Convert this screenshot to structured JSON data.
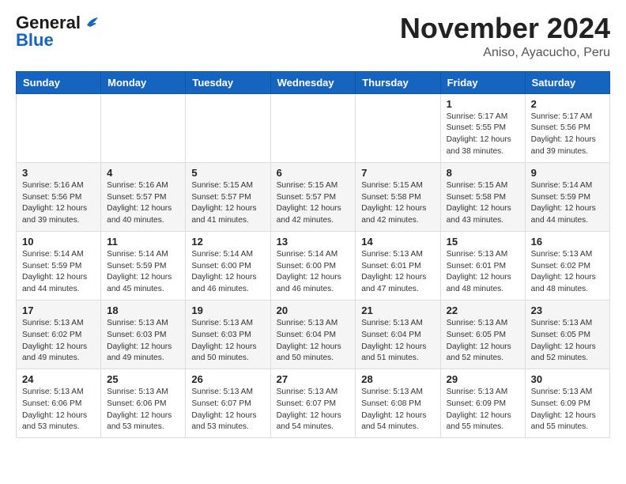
{
  "header": {
    "logo_line1": "General",
    "logo_line2": "Blue",
    "title": "November 2024",
    "subtitle": "Aniso, Ayacucho, Peru"
  },
  "weekdays": [
    "Sunday",
    "Monday",
    "Tuesday",
    "Wednesday",
    "Thursday",
    "Friday",
    "Saturday"
  ],
  "weeks": [
    [
      {
        "day": "",
        "info": ""
      },
      {
        "day": "",
        "info": ""
      },
      {
        "day": "",
        "info": ""
      },
      {
        "day": "",
        "info": ""
      },
      {
        "day": "",
        "info": ""
      },
      {
        "day": "1",
        "info": "Sunrise: 5:17 AM\nSunset: 5:55 PM\nDaylight: 12 hours\nand 38 minutes."
      },
      {
        "day": "2",
        "info": "Sunrise: 5:17 AM\nSunset: 5:56 PM\nDaylight: 12 hours\nand 39 minutes."
      }
    ],
    [
      {
        "day": "3",
        "info": "Sunrise: 5:16 AM\nSunset: 5:56 PM\nDaylight: 12 hours\nand 39 minutes."
      },
      {
        "day": "4",
        "info": "Sunrise: 5:16 AM\nSunset: 5:57 PM\nDaylight: 12 hours\nand 40 minutes."
      },
      {
        "day": "5",
        "info": "Sunrise: 5:15 AM\nSunset: 5:57 PM\nDaylight: 12 hours\nand 41 minutes."
      },
      {
        "day": "6",
        "info": "Sunrise: 5:15 AM\nSunset: 5:57 PM\nDaylight: 12 hours\nand 42 minutes."
      },
      {
        "day": "7",
        "info": "Sunrise: 5:15 AM\nSunset: 5:58 PM\nDaylight: 12 hours\nand 42 minutes."
      },
      {
        "day": "8",
        "info": "Sunrise: 5:15 AM\nSunset: 5:58 PM\nDaylight: 12 hours\nand 43 minutes."
      },
      {
        "day": "9",
        "info": "Sunrise: 5:14 AM\nSunset: 5:59 PM\nDaylight: 12 hours\nand 44 minutes."
      }
    ],
    [
      {
        "day": "10",
        "info": "Sunrise: 5:14 AM\nSunset: 5:59 PM\nDaylight: 12 hours\nand 44 minutes."
      },
      {
        "day": "11",
        "info": "Sunrise: 5:14 AM\nSunset: 5:59 PM\nDaylight: 12 hours\nand 45 minutes."
      },
      {
        "day": "12",
        "info": "Sunrise: 5:14 AM\nSunset: 6:00 PM\nDaylight: 12 hours\nand 46 minutes."
      },
      {
        "day": "13",
        "info": "Sunrise: 5:14 AM\nSunset: 6:00 PM\nDaylight: 12 hours\nand 46 minutes."
      },
      {
        "day": "14",
        "info": "Sunrise: 5:13 AM\nSunset: 6:01 PM\nDaylight: 12 hours\nand 47 minutes."
      },
      {
        "day": "15",
        "info": "Sunrise: 5:13 AM\nSunset: 6:01 PM\nDaylight: 12 hours\nand 48 minutes."
      },
      {
        "day": "16",
        "info": "Sunrise: 5:13 AM\nSunset: 6:02 PM\nDaylight: 12 hours\nand 48 minutes."
      }
    ],
    [
      {
        "day": "17",
        "info": "Sunrise: 5:13 AM\nSunset: 6:02 PM\nDaylight: 12 hours\nand 49 minutes."
      },
      {
        "day": "18",
        "info": "Sunrise: 5:13 AM\nSunset: 6:03 PM\nDaylight: 12 hours\nand 49 minutes."
      },
      {
        "day": "19",
        "info": "Sunrise: 5:13 AM\nSunset: 6:03 PM\nDaylight: 12 hours\nand 50 minutes."
      },
      {
        "day": "20",
        "info": "Sunrise: 5:13 AM\nSunset: 6:04 PM\nDaylight: 12 hours\nand 50 minutes."
      },
      {
        "day": "21",
        "info": "Sunrise: 5:13 AM\nSunset: 6:04 PM\nDaylight: 12 hours\nand 51 minutes."
      },
      {
        "day": "22",
        "info": "Sunrise: 5:13 AM\nSunset: 6:05 PM\nDaylight: 12 hours\nand 52 minutes."
      },
      {
        "day": "23",
        "info": "Sunrise: 5:13 AM\nSunset: 6:05 PM\nDaylight: 12 hours\nand 52 minutes."
      }
    ],
    [
      {
        "day": "24",
        "info": "Sunrise: 5:13 AM\nSunset: 6:06 PM\nDaylight: 12 hours\nand 53 minutes."
      },
      {
        "day": "25",
        "info": "Sunrise: 5:13 AM\nSunset: 6:06 PM\nDaylight: 12 hours\nand 53 minutes."
      },
      {
        "day": "26",
        "info": "Sunrise: 5:13 AM\nSunset: 6:07 PM\nDaylight: 12 hours\nand 53 minutes."
      },
      {
        "day": "27",
        "info": "Sunrise: 5:13 AM\nSunset: 6:07 PM\nDaylight: 12 hours\nand 54 minutes."
      },
      {
        "day": "28",
        "info": "Sunrise: 5:13 AM\nSunset: 6:08 PM\nDaylight: 12 hours\nand 54 minutes."
      },
      {
        "day": "29",
        "info": "Sunrise: 5:13 AM\nSunset: 6:09 PM\nDaylight: 12 hours\nand 55 minutes."
      },
      {
        "day": "30",
        "info": "Sunrise: 5:13 AM\nSunset: 6:09 PM\nDaylight: 12 hours\nand 55 minutes."
      }
    ]
  ]
}
